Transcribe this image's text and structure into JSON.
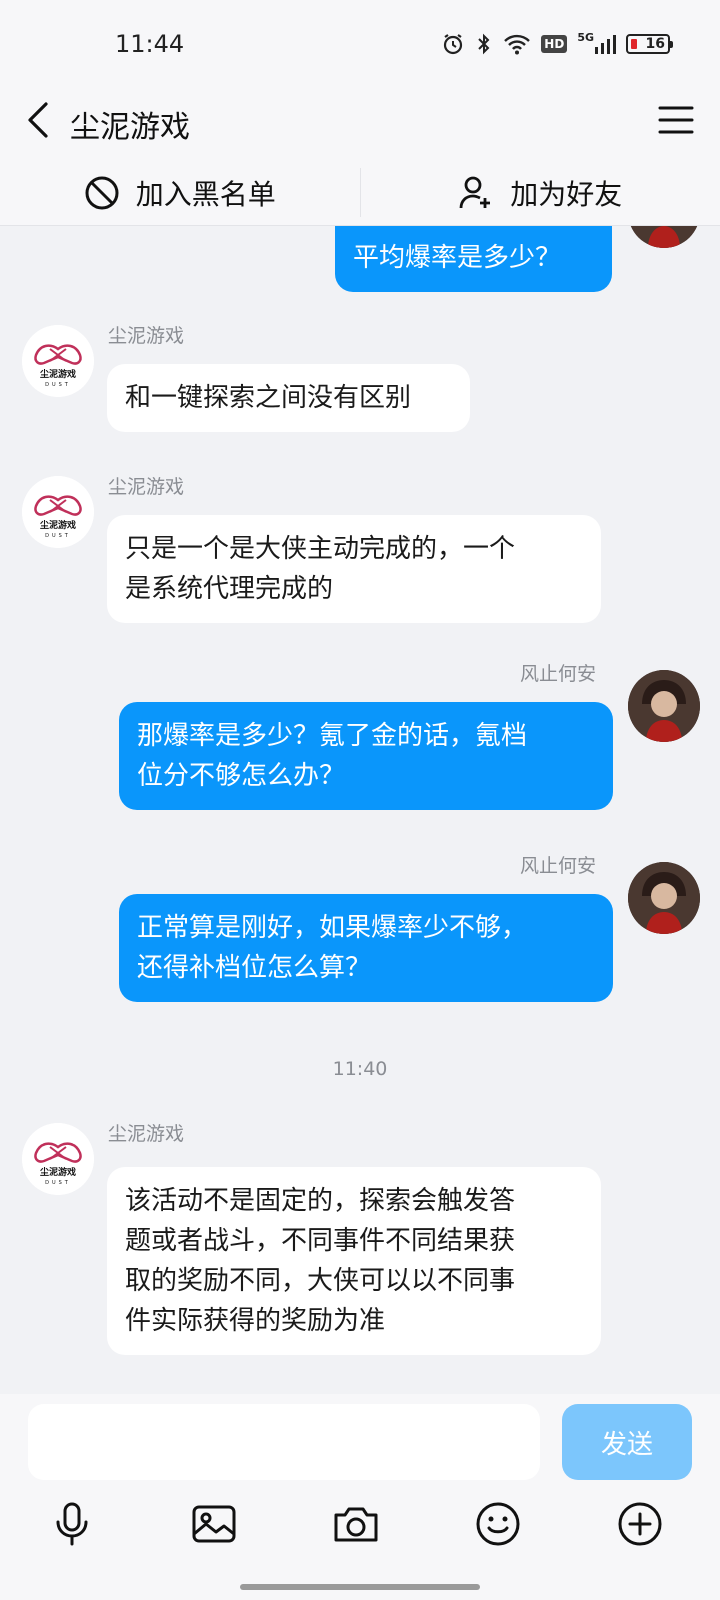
{
  "status_bar": {
    "time": "11:44",
    "network": "5G",
    "hd": "HD",
    "battery": "16",
    "icons": [
      "alarm-icon",
      "bluetooth-icon",
      "wifi-icon",
      "hd-icon",
      "signal-icon",
      "battery-icon"
    ]
  },
  "header": {
    "title": "尘泥游戏",
    "back_icon": "chevron-left-icon",
    "menu_icon": "hamburger-menu-icon"
  },
  "actions": {
    "block_label": "加入黑名单",
    "add_friend_label": "加为好友"
  },
  "messages": [
    {
      "side": "out",
      "text": "平均爆率是多少？"
    },
    {
      "side": "in",
      "sender": "尘泥游戏",
      "text": "和一键探索之间没有区别"
    },
    {
      "side": "in",
      "sender": "尘泥游戏",
      "line1": "只是一个是大侠主动完成的，一个",
      "line2": "是系统代理完成的"
    },
    {
      "side": "out",
      "sender": "风止何安",
      "line1": "那爆率是多少？氪了金的话，氪档",
      "line2": "位分不够怎么办？"
    },
    {
      "side": "out",
      "sender": "风止何安",
      "line1": "正常算是刚好，如果爆率少不够，",
      "line2": "还得补档位怎么算？"
    },
    {
      "side": "in",
      "sender": "尘泥游戏",
      "line1": "该活动不是固定的，探索会触发答",
      "line2": "题或者战斗，不同事件不同结果获",
      "line3": "取的奖励不同，大侠可以以不同事",
      "line4": "件实际获得的奖励为准"
    }
  ],
  "timestamp": "11:40",
  "brand_logo_text": "尘泥游戏",
  "brand_logo_sub": "DUST",
  "input": {
    "placeholder": "",
    "send_label": "发送"
  },
  "toolbar": [
    "microphone-icon",
    "image-icon",
    "camera-icon",
    "emoji-icon",
    "plus-icon"
  ],
  "colors": {
    "outgoing_bubble": "#0a96fb",
    "send_button": "#7cc6fc",
    "background": "#f1f2f5"
  }
}
